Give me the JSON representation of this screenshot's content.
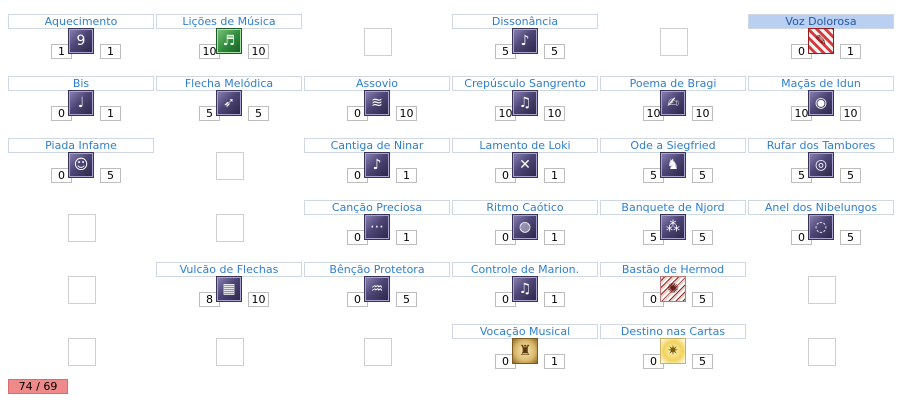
{
  "skills": [
    {
      "label": "Aquecimento",
      "level": "1",
      "max": "1",
      "icon": "bard-skill-icon",
      "glyph": "9",
      "style": "",
      "selected": false
    },
    {
      "label": "Lições de Música",
      "level": "10",
      "max": "10",
      "icon": "music-lessons-icon",
      "glyph": "♬",
      "style": "green",
      "selected": false
    },
    {
      "label": "Dissonância",
      "level": "5",
      "max": "5",
      "icon": "dissonance-icon",
      "glyph": "♪",
      "style": "",
      "selected": false
    },
    {
      "label": "Voz Dolorosa",
      "level": "0",
      "max": "1",
      "icon": "painful-voice-icon",
      "glyph": "✎",
      "style": "red",
      "selected": true
    },
    {
      "label": "Bis",
      "level": "0",
      "max": "1",
      "icon": "encore-icon",
      "glyph": "♩",
      "style": "",
      "selected": false
    },
    {
      "label": "Flecha Melódica",
      "level": "5",
      "max": "5",
      "icon": "melody-arrow-icon",
      "glyph": "➶",
      "style": "",
      "selected": false
    },
    {
      "label": "Assovio",
      "level": "0",
      "max": "10",
      "icon": "whistle-icon",
      "glyph": "≋",
      "style": "",
      "selected": false
    },
    {
      "label": "Crepúsculo Sangrento",
      "level": "10",
      "max": "10",
      "icon": "bloody-twilight-icon",
      "glyph": "♫",
      "style": "",
      "selected": false
    },
    {
      "label": "Poema de Bragi",
      "level": "10",
      "max": "10",
      "icon": "bragi-poem-icon",
      "glyph": "✍",
      "style": "",
      "selected": false
    },
    {
      "label": "Maçãs de Idun",
      "level": "10",
      "max": "10",
      "icon": "idun-apple-icon",
      "glyph": "◉",
      "style": "",
      "selected": false
    },
    {
      "label": "Piada Infame",
      "level": "0",
      "max": "5",
      "icon": "joke-icon",
      "glyph": "☺",
      "style": "",
      "selected": false
    },
    {
      "label": "Cantiga de Ninar",
      "level": "0",
      "max": "1",
      "icon": "lullaby-icon",
      "glyph": "♪",
      "style": "",
      "selected": false
    },
    {
      "label": "Lamento de Loki",
      "level": "0",
      "max": "1",
      "icon": "loki-lament-icon",
      "glyph": "✕",
      "style": "",
      "selected": false
    },
    {
      "label": "Ode a Siegfried",
      "level": "5",
      "max": "5",
      "icon": "siegfried-ode-icon",
      "glyph": "♞",
      "style": "",
      "selected": false
    },
    {
      "label": "Rufar dos Tambores",
      "level": "5",
      "max": "5",
      "icon": "drum-roll-icon",
      "glyph": "◎",
      "style": "",
      "selected": false
    },
    {
      "label": "Canção Preciosa",
      "level": "0",
      "max": "1",
      "icon": "precious-song-icon",
      "glyph": "⋯",
      "style": "",
      "selected": false
    },
    {
      "label": "Ritmo Caótico",
      "level": "0",
      "max": "1",
      "icon": "chaotic-rhythm-icon",
      "glyph": "◍",
      "style": "",
      "selected": false
    },
    {
      "label": "Banquete de Njord",
      "level": "5",
      "max": "5",
      "icon": "njord-feast-icon",
      "glyph": "⁂",
      "style": "",
      "selected": false
    },
    {
      "label": "Anel dos Nibelungos",
      "level": "0",
      "max": "5",
      "icon": "nibelungen-ring-icon",
      "glyph": "◌",
      "style": "",
      "selected": false
    },
    {
      "label": "Vulcão de Flechas",
      "level": "8",
      "max": "10",
      "icon": "arrow-vulcan-icon",
      "glyph": "▦",
      "style": "",
      "selected": false
    },
    {
      "label": "Bênção Protetora",
      "level": "0",
      "max": "5",
      "icon": "protective-blessing-icon",
      "glyph": "♒",
      "style": "",
      "selected": false
    },
    {
      "label": "Controle de Marion.",
      "level": "0",
      "max": "1",
      "icon": "marionette-control-icon",
      "glyph": "♫",
      "style": "",
      "selected": false
    },
    {
      "label": "Bastão de Hermod",
      "level": "0",
      "max": "5",
      "icon": "hermod-staff-icon",
      "glyph": "✺",
      "style": "noise",
      "selected": false
    },
    {
      "label": "Vocação Musical",
      "level": "0",
      "max": "1",
      "icon": "musical-vocation-icon",
      "glyph": "♜",
      "style": "cream",
      "selected": false
    },
    {
      "label": "Destino nas Cartas",
      "level": "0",
      "max": "5",
      "icon": "tarot-card-icon",
      "glyph": "✷",
      "style": "star",
      "selected": false
    }
  ],
  "skill_points": "74 / 69"
}
